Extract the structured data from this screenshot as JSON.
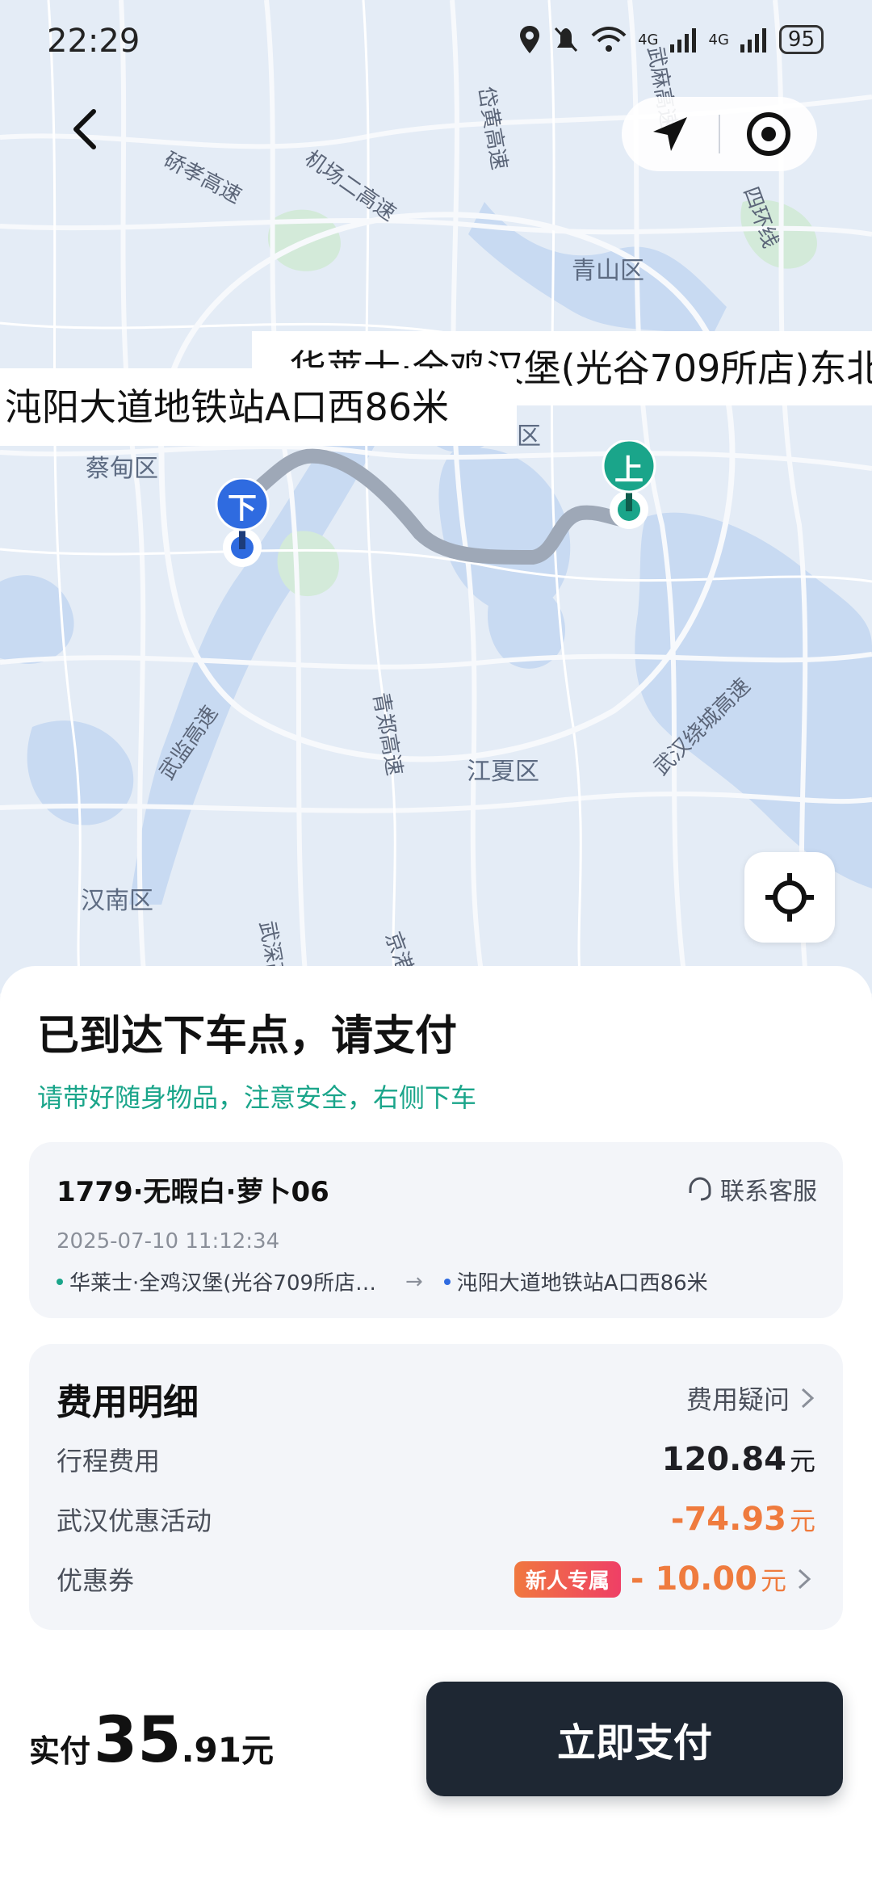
{
  "status_bar": {
    "time": "22:29",
    "battery": "95",
    "net1": "4G",
    "net2": "4G"
  },
  "map": {
    "labels": {
      "qingshan": "青山区",
      "caidian": "蔡甸区",
      "jiangxia": "江夏区",
      "hannan": "汉南区",
      "qu_partial": "区"
    },
    "roads": {
      "yanxiao": "硚孝高速",
      "airport2": "机场二高速",
      "daihuang": "岱黄高速",
      "wuma": "武麻高速",
      "ring4": "四环线",
      "qingzheng": "青郑高速",
      "wujian": "武监高速",
      "wuhanring": "武汉绕城高速",
      "wushen": "武深高",
      "jinggang": "京港"
    },
    "pickup_label": "华莱士·全鸡汉堡(光谷709所店)东北",
    "dropoff_label": "沌阳大道地铁站A口西86米",
    "pickup_pin": "上",
    "dropoff_pin": "下"
  },
  "sheet": {
    "title": "已到达下车点，请支付",
    "subtitle": "请带好随身物品，注意安全，右侧下车"
  },
  "trip": {
    "plate": "1779·无暇白·萝卜06",
    "service": "联系客服",
    "timestamp": "2025-07-10 11:12:34",
    "from": "华莱士·全鸡汉堡(光谷709所店…",
    "to": "沌阳大道地铁站A口西86米",
    "arrow": "→",
    "from_color": "#1aa58a",
    "to_color": "#2f6be0"
  },
  "fees": {
    "title": "费用明细",
    "question": "费用疑问",
    "trip_fee_label": "行程费用",
    "trip_fee": "120.84",
    "promo_label": "武汉优惠活动",
    "promo": "-74.93",
    "coupon_label": "优惠券",
    "coupon_badge": "新人专属",
    "coupon": "- 10.00",
    "unit": "元"
  },
  "payment": {
    "prefix": "实付",
    "int": "35",
    "dec": ".91",
    "unit": "元",
    "button": "立即支付"
  },
  "colors": {
    "accent_green": "#1aa58a",
    "accent_blue": "#2f6be0",
    "discount": "#ef7b3e",
    "pay_button": "#1e2733"
  }
}
